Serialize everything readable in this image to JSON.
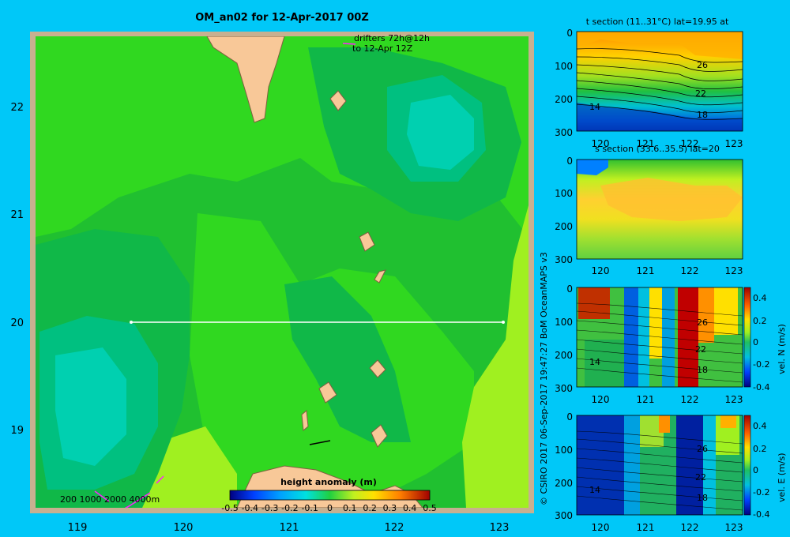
{
  "title": "OM_an02 for 12-Apr-2017 00Z",
  "drifters": {
    "line1": "drifters 72h@12h",
    "line2": "to 12-Apr 12Z"
  },
  "map": {
    "x_ticks": [
      "119",
      "120",
      "121",
      "122",
      "123"
    ],
    "y_ticks": [
      "22",
      "21",
      "20",
      "19"
    ],
    "depth_legend": "200  1000  2000  4000m",
    "section_latitude": 20
  },
  "colorbar": {
    "title": "height anomaly (m)",
    "ticks": [
      "-0.5",
      "-0.4",
      "-0.3",
      "-0.2",
      "-0.1",
      "0",
      "0.1",
      "0.2",
      "0.3",
      "0.4",
      "0.5"
    ],
    "range": [
      -0.5,
      0.5
    ]
  },
  "credit": "© CSIRO 2017   06-Sep-2017 19:47:27 BoM OceanMAPS v3",
  "panels": [
    {
      "title": "t section (11..31°C) lat=19.95 at",
      "y_ticks": [
        "0",
        "100",
        "200",
        "300"
      ],
      "x_ticks": [
        "120",
        "121",
        "122",
        "123"
      ],
      "labels": [
        "26",
        "22",
        "18",
        "14"
      ]
    },
    {
      "title": "s section (33.6..35.5) lat=20",
      "y_ticks": [
        "0",
        "100",
        "200",
        "300"
      ],
      "x_ticks": [
        "120",
        "121",
        "122",
        "123"
      ]
    },
    {
      "title": "",
      "y_ticks": [
        "0",
        "100",
        "200",
        "300"
      ],
      "x_ticks": [
        "120",
        "121",
        "122",
        "123"
      ],
      "labels": [
        "26",
        "22",
        "18",
        "14"
      ],
      "cbar_label": "vel. N (m/s)",
      "cbar_ticks": [
        "0.4",
        "0.2",
        "0",
        "-0.2",
        "-0.4"
      ]
    },
    {
      "title": "",
      "y_ticks": [
        "0",
        "100",
        "200",
        "300"
      ],
      "x_ticks": [
        "120",
        "121",
        "122",
        "123"
      ],
      "labels": [
        "26",
        "22",
        "18",
        "14"
      ],
      "cbar_label": "vel. E (m/s)",
      "cbar_ticks": [
        "0.4",
        "0.2",
        "0",
        "-0.2",
        "-0.4"
      ]
    }
  ],
  "colors": {
    "land": "#f8c898",
    "frame": "#c8b090",
    "background": "#00c8f8",
    "field_mid": "#10b848",
    "field_high": "#30d820"
  }
}
